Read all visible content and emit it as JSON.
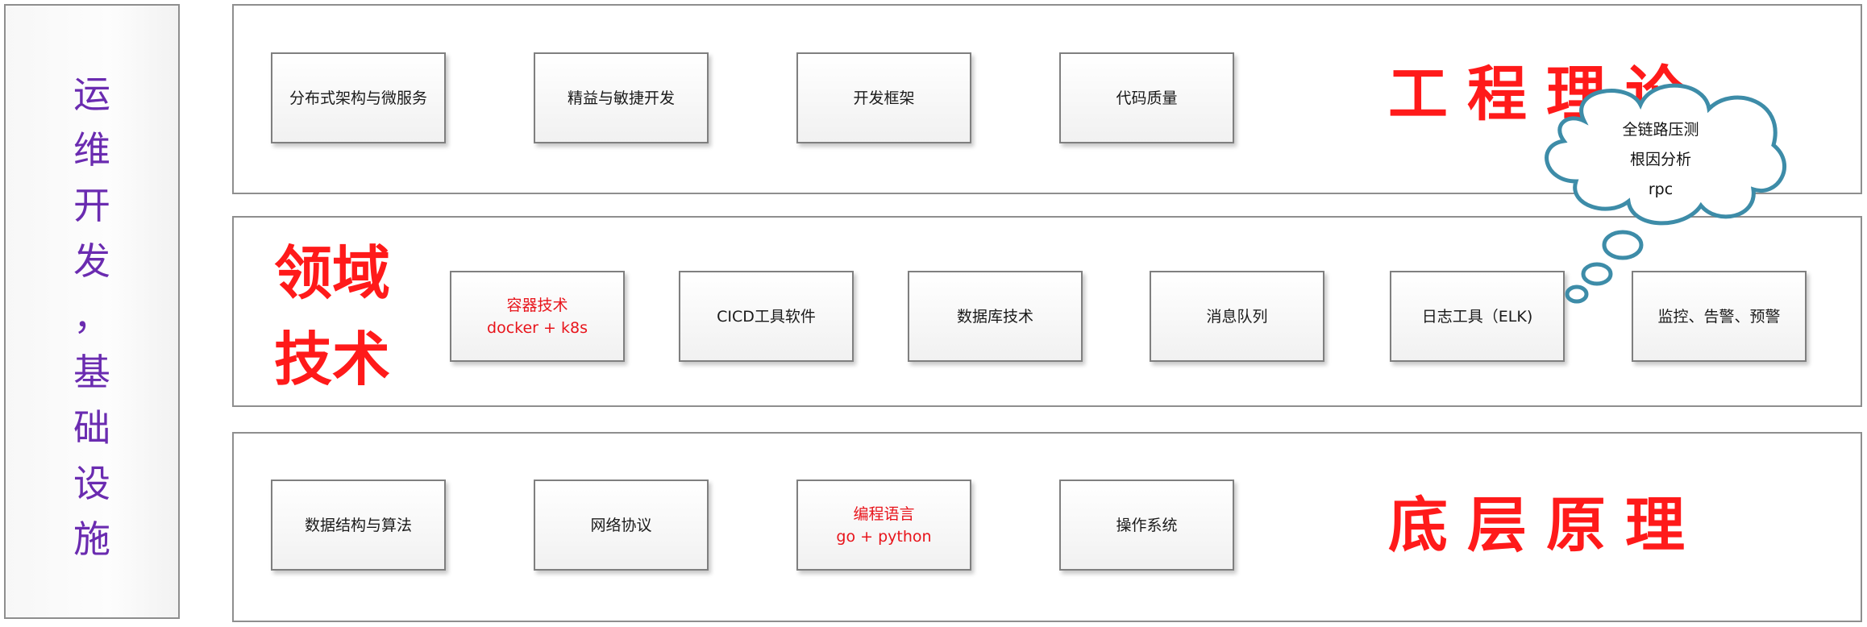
{
  "side_panel": {
    "chars": [
      "运",
      "维",
      "开",
      "发",
      "，",
      "基",
      "础",
      "设",
      "施"
    ]
  },
  "layers": {
    "top": {
      "title": "工程理论",
      "boxes": [
        "分布式架构与微服务",
        "精益与敏捷开发",
        "开发框架",
        "代码质量"
      ]
    },
    "middle": {
      "title_line1": "领域",
      "title_line2": "技术",
      "boxes": [
        {
          "line1": "容器技术",
          "line2": "docker + k8s"
        },
        {
          "line1": "CICD工具软件"
        },
        {
          "line1": "数据库技术"
        },
        {
          "line1": "消息队列"
        },
        {
          "line1": "日志工具（ELK)"
        },
        {
          "line1": "监控、告警、预警"
        }
      ]
    },
    "bottom": {
      "title": "底层原理",
      "boxes": [
        "数据结构与算法",
        "网络协议",
        {
          "line1": "编程语言",
          "line2": "go + python"
        },
        "操作系统"
      ]
    }
  },
  "cloud": {
    "lines": [
      "全链路压测",
      "根因分析",
      "rpc"
    ]
  },
  "colors": {
    "accent_red": "#ff1a1a",
    "box_red_text": "#e8141b",
    "side_purple": "#6a2bb0",
    "cloud_stroke": "#3d8ca8"
  }
}
